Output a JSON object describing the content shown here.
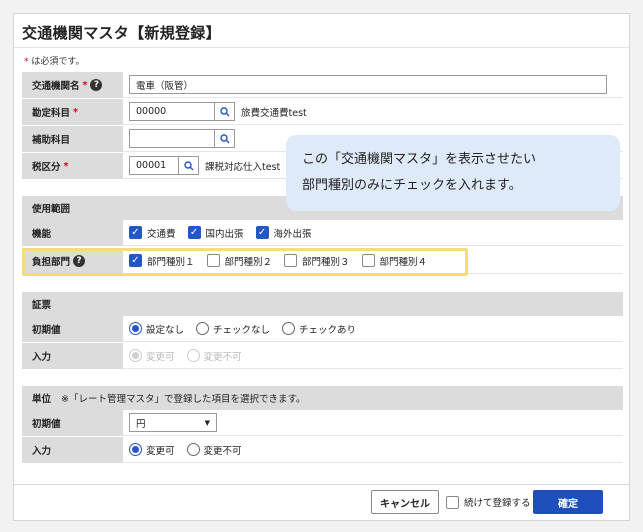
{
  "title": "交通機関マスタ【新規登録】",
  "required_note": {
    "star": "*",
    "text": " は必須です。"
  },
  "fields": {
    "transport_name": {
      "label": "交通機関名",
      "value": "電車（阪管）"
    },
    "account": {
      "label": "勘定科目",
      "value": "00000",
      "after": "旅費交通費test"
    },
    "sub_account": {
      "label": "補助科目",
      "value": ""
    },
    "tax_category": {
      "label": "税区分",
      "value": "00001",
      "after": "課税対応仕入test"
    }
  },
  "scope": {
    "section": "使用範囲",
    "function_label": "機能",
    "functions": [
      "交通費",
      "国内出張",
      "海外出張"
    ],
    "department_label": "負担部門",
    "departments": [
      "部門種別１",
      "部門種別２",
      "部門種別３",
      "部門種別４"
    ]
  },
  "voucher": {
    "section": "証票",
    "initial_label": "初期値",
    "initial_options": [
      "設定なし",
      "チェックなし",
      "チェックあり"
    ],
    "input_label": "入力",
    "input_options": [
      "変更可",
      "変更不可"
    ]
  },
  "unit": {
    "section": "単位",
    "note": "※「レート管理マスタ」で登録した項目を選択できます。",
    "initial_label": "初期値",
    "initial_value": "円",
    "input_label": "入力",
    "input_options": [
      "変更可",
      "変更不可"
    ]
  },
  "callout": {
    "line1": "この「交通機関マスタ」を表示させたい",
    "line2": "部門種別のみにチェックを入れます。"
  },
  "footer": {
    "cancel": "キャンセル",
    "continue": "続けて登録する",
    "confirm": "確定"
  }
}
